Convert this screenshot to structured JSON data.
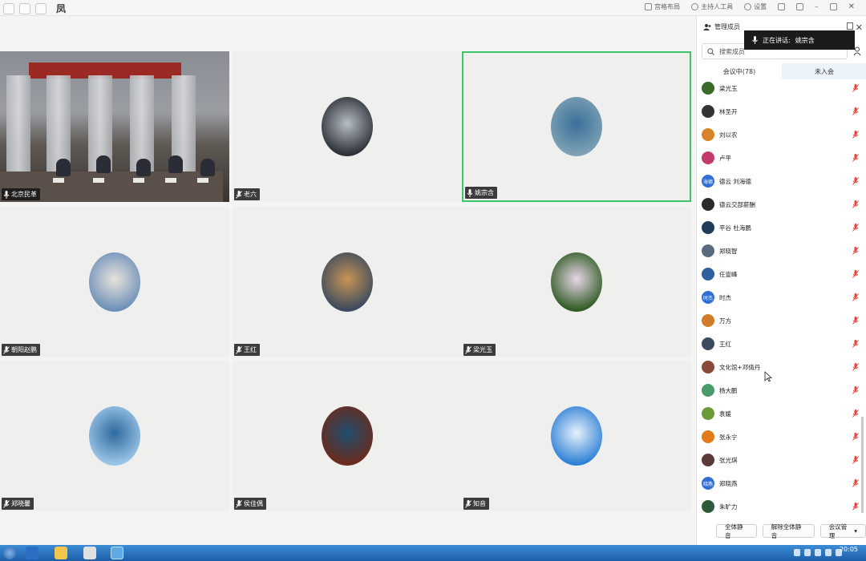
{
  "top_bar": {
    "title_glyph": "凤",
    "tools": [
      "宫格布局",
      "主持人工具",
      "设置"
    ]
  },
  "speaking": {
    "label": "正在讲话:",
    "name": "姚宗含"
  },
  "tiles": [
    {
      "name": "北京民革",
      "kind": "room"
    },
    {
      "name": "老六",
      "kind": "avatar",
      "colors": [
        "#2b2f36",
        "#b8bec6"
      ]
    },
    {
      "name": "姚宗含",
      "kind": "avatar",
      "colors": [
        "#7fa2b4",
        "#3a6f9a"
      ],
      "active": true
    },
    {
      "name": "朝阳赵鹏",
      "kind": "avatar",
      "colors": [
        "#6d8fb8",
        "#e7e4dd"
      ]
    },
    {
      "name": "王红",
      "kind": "avatar",
      "colors": [
        "#3b4a5e",
        "#c89454"
      ]
    },
    {
      "name": "梁光玉",
      "kind": "avatar",
      "colors": [
        "#2f5b22",
        "#e8d7ea"
      ]
    },
    {
      "name": "郑晓馨",
      "kind": "avatar",
      "colors": [
        "#9cc6e8",
        "#2e6a9e"
      ]
    },
    {
      "name": "侯佳偶",
      "kind": "avatar",
      "colors": [
        "#6b2a1c",
        "#1f4f6e"
      ]
    },
    {
      "name": "知音",
      "kind": "avatar",
      "colors": [
        "#2d7fd6",
        "#e8f2fb"
      ]
    }
  ],
  "sidebar": {
    "title": "管理成员",
    "search_placeholder": "搜索成员",
    "tabs": [
      {
        "label": "会议中(78)"
      },
      {
        "label": "未入会"
      }
    ],
    "members": [
      {
        "name": "梁光玉",
        "avatar": "#3a6b2a",
        "text": ""
      },
      {
        "name": "林圣开",
        "avatar": "#333333",
        "text": ""
      },
      {
        "name": "刘以农",
        "avatar": "#d9832a",
        "text": ""
      },
      {
        "name": "卢平",
        "avatar": "#c43a6a",
        "text": ""
      },
      {
        "name": "德云 刘海德",
        "avatar": "#2f6fd6",
        "text": "海德"
      },
      {
        "name": "德云交部薪酬",
        "avatar": "#2b2b2b",
        "text": ""
      },
      {
        "name": "平谷 杜海鹏",
        "avatar": "#1e3c5a",
        "text": ""
      },
      {
        "name": "郑晓智",
        "avatar": "#5a6a80",
        "text": ""
      },
      {
        "name": "任壹峰",
        "avatar": "#2f5f9f",
        "text": ""
      },
      {
        "name": "时杰",
        "avatar": "#2f6fd6",
        "text": "时杰"
      },
      {
        "name": "万方",
        "avatar": "#d07a2a",
        "text": ""
      },
      {
        "name": "王红",
        "avatar": "#3b4a5e",
        "text": ""
      },
      {
        "name": "文化馆+邓倩丹",
        "avatar": "#8a4a3a",
        "text": ""
      },
      {
        "name": "杨大鹏",
        "avatar": "#4a9a6a",
        "text": ""
      },
      {
        "name": "袁媛",
        "avatar": "#6a9a3a",
        "text": ""
      },
      {
        "name": "张永宁",
        "avatar": "#e07a1a",
        "text": ""
      },
      {
        "name": "张光琪",
        "avatar": "#5a3a3a",
        "text": ""
      },
      {
        "name": "郑晓燕",
        "avatar": "#2f6fd6",
        "text": "晓燕"
      },
      {
        "name": "朱旷力",
        "avatar": "#2f5a3a",
        "text": ""
      }
    ],
    "buttons": [
      {
        "label": "全体静音"
      },
      {
        "label": "解除全体静音"
      },
      {
        "label": "会议管理"
      }
    ]
  },
  "taskbar": {
    "time": "20:05"
  },
  "colors": {
    "accent_green": "#3bc46a",
    "mute_red": "#e0443a",
    "brand_blue": "#2f6fd6"
  }
}
